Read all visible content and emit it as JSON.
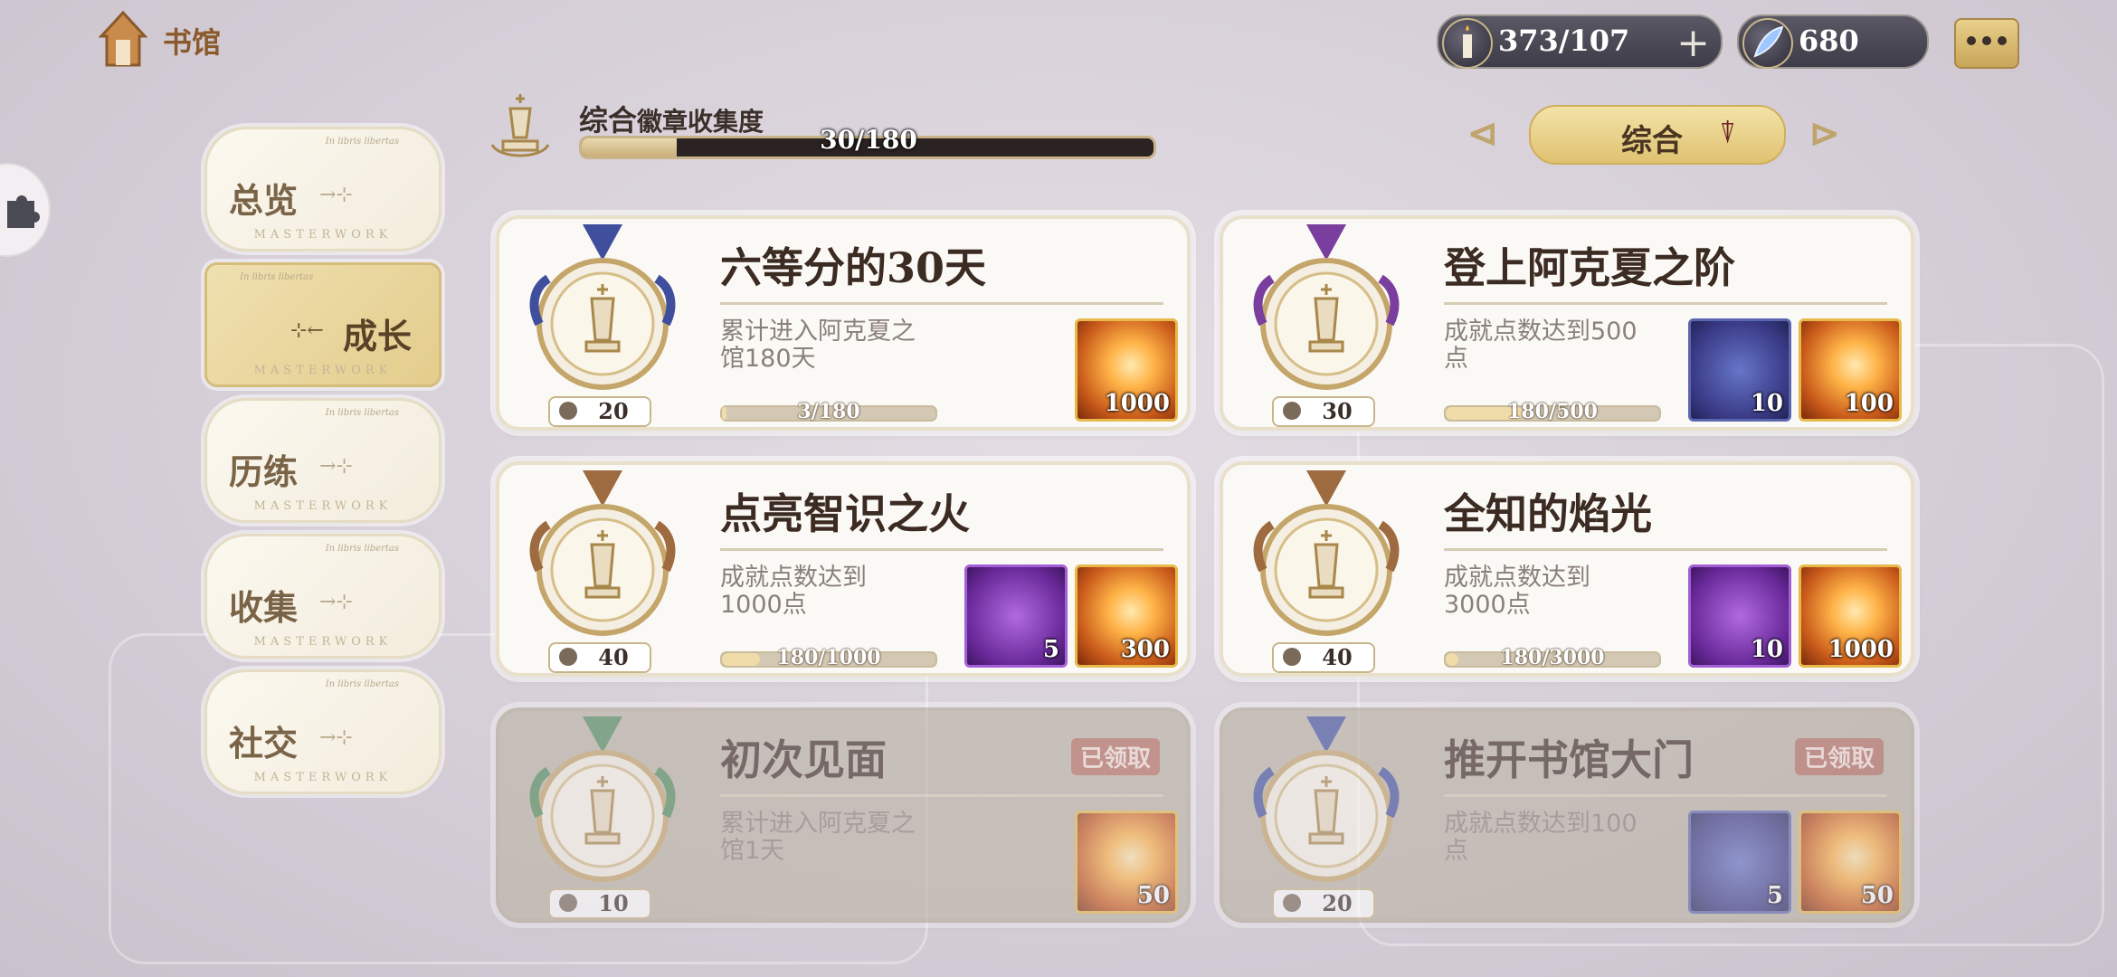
{
  "header": {
    "home_label": "书馆",
    "candle_value": "373/107",
    "crystal_value": "680"
  },
  "sidebar": {
    "items": [
      {
        "label": "总览",
        "tag": "In libris libertas",
        "sub": "MASTERWORK"
      },
      {
        "label": "成长",
        "tag": "In libris libertas",
        "sub": "MASTERWORK",
        "active": true
      },
      {
        "label": "历练",
        "tag": "In libris libertas",
        "sub": "MASTERWORK"
      },
      {
        "label": "收集",
        "tag": "In libris libertas",
        "sub": "MASTERWORK"
      },
      {
        "label": "社交",
        "tag": "In libris libertas",
        "sub": "MASTERWORK"
      }
    ]
  },
  "collection": {
    "title_main": "综合",
    "title_rest": "徽章收集度",
    "progress_text": "30/180",
    "progress_fraction": 0.1667
  },
  "filter": {
    "label": "综合",
    "prev": "⊲",
    "next": "⊳"
  },
  "cards": [
    {
      "title": "六等分的30天",
      "desc": "累计进入阿克夏之馆180天",
      "level": "20",
      "progress": "3/180",
      "fraction": 0.017,
      "medal": "blue",
      "rewards": [
        {
          "type": "feather",
          "count": "1000"
        }
      ]
    },
    {
      "title": "登上阿克夏之阶",
      "desc": "成就点数达到500点",
      "level": "30",
      "progress": "180/500",
      "fraction": 0.36,
      "medal": "purple",
      "rewards": [
        {
          "type": "gift-blue",
          "count": "10"
        },
        {
          "type": "feather",
          "count": "100"
        }
      ]
    },
    {
      "title": "点亮智识之火",
      "desc": "成就点数达到1000点",
      "level": "40",
      "progress": "180/1000",
      "fraction": 0.18,
      "medal": "bronze",
      "rewards": [
        {
          "type": "gift-purple",
          "count": "5"
        },
        {
          "type": "feather",
          "count": "300"
        }
      ]
    },
    {
      "title": "全知的焰光",
      "desc": "成就点数达到3000点",
      "level": "40",
      "progress": "180/3000",
      "fraction": 0.06,
      "medal": "bronze",
      "rewards": [
        {
          "type": "gift-purple",
          "count": "10"
        },
        {
          "type": "feather",
          "count": "1000"
        }
      ]
    },
    {
      "title": "初次见面",
      "desc": "累计进入阿克夏之馆1天",
      "level": "10",
      "claimed": "已领取",
      "medal": "green",
      "rewards": [
        {
          "type": "feather",
          "count": "50"
        }
      ]
    },
    {
      "title": "推开书馆大门",
      "desc": "成就点数达到100点",
      "level": "20",
      "claimed": "已领取",
      "medal": "blue",
      "rewards": [
        {
          "type": "gift-blue",
          "count": "5"
        },
        {
          "type": "feather",
          "count": "50"
        }
      ]
    }
  ],
  "colors": {
    "medal_blue": "#3f4f9e",
    "medal_purple": "#7a3f9e",
    "medal_bronze": "#9e6a3f",
    "medal_green": "#4f8a5a"
  }
}
